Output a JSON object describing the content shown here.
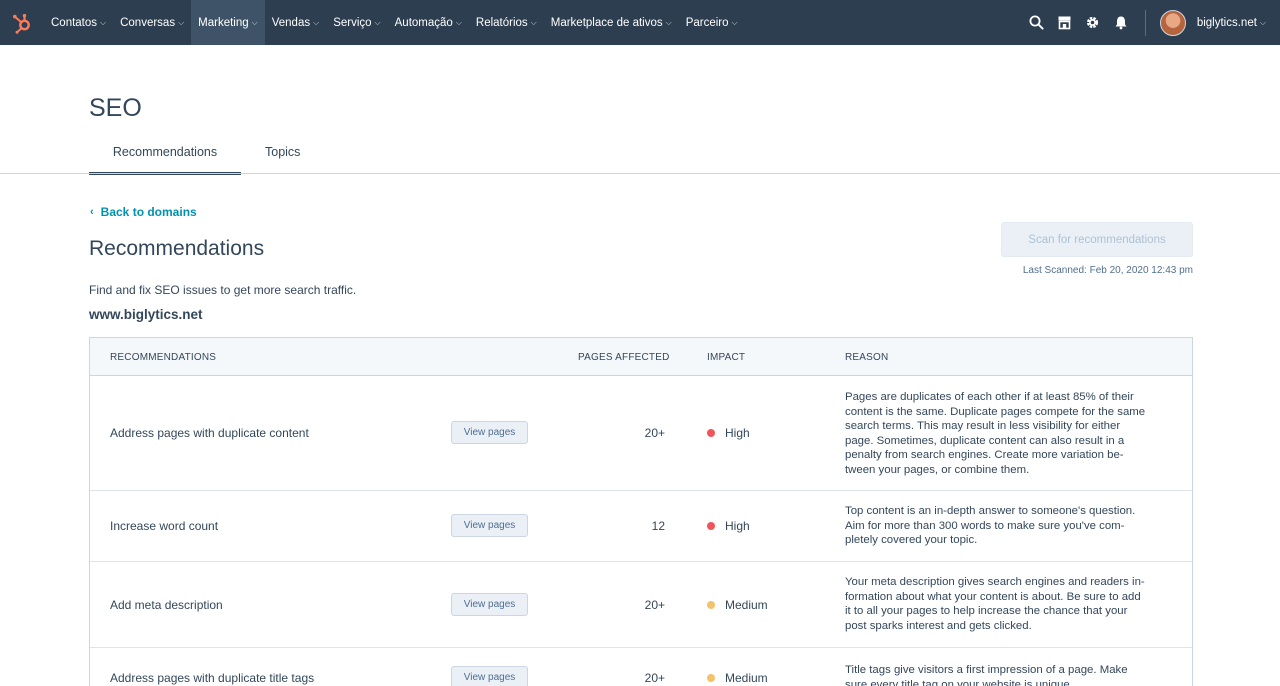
{
  "nav": {
    "items": [
      {
        "label": "Contatos",
        "active": false
      },
      {
        "label": "Conversas",
        "active": false
      },
      {
        "label": "Marketing",
        "active": true
      },
      {
        "label": "Vendas",
        "active": false
      },
      {
        "label": "Serviço",
        "active": false
      },
      {
        "label": "Automação",
        "active": false
      },
      {
        "label": "Relatórios",
        "active": false
      },
      {
        "label": "Marketplace de ativos",
        "active": false
      },
      {
        "label": "Parceiro",
        "active": false
      }
    ],
    "account": "biglytics.net",
    "icons": [
      "search-icon",
      "marketplace-icon",
      "settings-icon",
      "notifications-icon"
    ]
  },
  "page": {
    "title": "SEO",
    "tabs": [
      "Recommendations",
      "Topics"
    ],
    "active_tab": "Recommendations"
  },
  "content": {
    "back_link": "Back to domains",
    "title": "Recommendations",
    "scan_button": "Scan for recommendations",
    "last_scanned": "Last Scanned: Feb 20, 2020 12:43 pm",
    "intro": "Find and fix SEO issues to get more search traffic.",
    "domain": "www.biglytics.net"
  },
  "table": {
    "headers": {
      "recommendations": "RECOMMENDATIONS",
      "pages_affected": "PAGES AFFECTED",
      "impact": "IMPACT",
      "reason": "REASON"
    },
    "view_label": "View pages",
    "rows": [
      {
        "name": "Address pages with duplicate content",
        "pages": "20+",
        "impact": "High",
        "impact_color": "#f2545b",
        "reason": [
          "Pages are duplicates of each other if at least 85% of their",
          "content is the same. Duplicate pages compete for the same",
          "search terms. This may result in less visibility for either",
          "page. Sometimes, duplicate content can also result in a",
          "penalty from search engines. Create more variation be-",
          "tween your pages, or combine them."
        ]
      },
      {
        "name": "Increase word count",
        "pages": "12",
        "impact": "High",
        "impact_color": "#f2545b",
        "reason": [
          "Top content is an in-depth answer to someone's question.",
          "Aim for more than 300 words to make sure you've com-",
          "pletely covered your topic."
        ]
      },
      {
        "name": "Add meta description",
        "pages": "20+",
        "impact": "Medium",
        "impact_color": "#f5c26b",
        "reason": [
          "Your meta description gives search engines and readers in-",
          "formation about what your content is about. Be sure to add",
          "it to all your pages to help increase the chance that your",
          "post sparks interest and gets clicked."
        ]
      },
      {
        "name": "Address pages with duplicate title tags",
        "pages": "20+",
        "impact": "Medium",
        "impact_color": "#f5c26b",
        "reason": [
          "Title tags give visitors a first impression of a page. Make",
          "sure every title tag on your website is unique."
        ]
      }
    ]
  },
  "colors": {
    "nav_bg": "#2d3e50",
    "accent": "#ff7a59",
    "link": "#0091ae",
    "high": "#f2545b",
    "medium": "#f5c26b"
  }
}
